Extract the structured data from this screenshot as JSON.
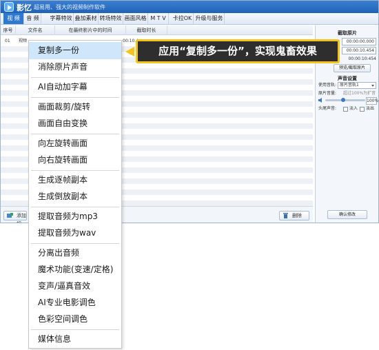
{
  "app": {
    "name": "影忆",
    "slogan": "超易用、强大的视频制作软件"
  },
  "tabs": [
    {
      "label": "视 频",
      "active": true
    },
    {
      "label": "音 频"
    },
    {
      "label": "字幕特效"
    },
    {
      "label": "叠加素材"
    },
    {
      "label": "转场特效"
    },
    {
      "label": "画面风格"
    },
    {
      "label": "M T V"
    },
    {
      "label": "卡拉OK"
    },
    {
      "label": "升级与服务"
    }
  ],
  "table": {
    "columns": [
      "序号",
      "文件名",
      "在最终影片中的时间",
      "截取时长"
    ],
    "rows": [
      {
        "index": "01",
        "filename": "视频",
        "time": "00:10.4"
      }
    ]
  },
  "footer": {
    "add_label": "添加视",
    "delete_label": "删除"
  },
  "right_panel": {
    "cut_title": "截取原片",
    "start_time": "00:00:00.000",
    "end_time": "00:00:10.454",
    "duration": "00:00:10:454",
    "preview_button": "预览/截取原片",
    "sound_title": "声音设置",
    "track_label": "使用音轨:",
    "track_value": "原片音轨1",
    "volume_label": "原片音量:",
    "volume_hint": "超过100%为扩音",
    "volume_value": "100%",
    "volume_level": 0.45,
    "fade_label": "头尾声音:",
    "fade_in": "淡入",
    "fade_out": "淡出",
    "confirm_button": "确认修改"
  },
  "context_menu": {
    "items": [
      {
        "label": "复制多一份",
        "highlighted": true
      },
      {
        "label": "消除原片声音"
      },
      {
        "label": "AI自动加字幕"
      },
      {
        "label": "画面裁剪/旋转"
      },
      {
        "label": "画面自由变换"
      },
      {
        "label": "向左旋转画面"
      },
      {
        "label": "向右旋转画面"
      },
      {
        "label": "生成逐帧副本"
      },
      {
        "label": "生成倒放副本"
      },
      {
        "label": "提取音频为mp3"
      },
      {
        "label": "提取音频为wav"
      },
      {
        "label": "分离出音频"
      },
      {
        "label": "魔术功能(变速/定格)"
      },
      {
        "label": "变声/逼真音效"
      },
      {
        "label": "AI专业电影调色"
      },
      {
        "label": "色彩空间调色"
      },
      {
        "label": "媒体信息"
      }
    ]
  },
  "callout": {
    "text": "应用“复制多一份”，实现鬼畜效果"
  },
  "colors": {
    "accent": "#2f78cf",
    "callout_border": "#f5c319",
    "callout_bg": "#2e2e2e",
    "menu_hover": "#cfe6fb"
  }
}
